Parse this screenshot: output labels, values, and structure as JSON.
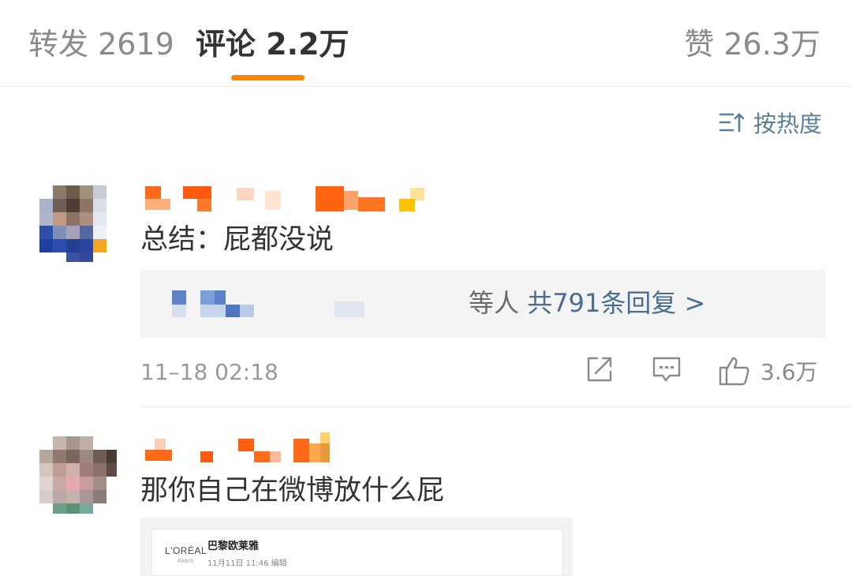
{
  "tabs": {
    "repost": "转发 2619",
    "comment": "评论 2.2万",
    "like": "赞 26.3万"
  },
  "sort": {
    "label": "按热度",
    "icon": "sort-icon"
  },
  "comments": [
    {
      "text": "总结：屁都没说",
      "reply_suffix": "等人",
      "reply_count": "共791条回复 >",
      "time": "11–18 02:18",
      "likes": "3.6万"
    },
    {
      "text": "那你自己在微博放什么屁",
      "embedded": {
        "logo": "L'ORÉAL",
        "logo_sub": "PARIS",
        "name": "巴黎欧莱雅",
        "date": "11月11日 11:46  编辑"
      }
    }
  ],
  "colors": {
    "accent": "#ff8200",
    "link": "#4b6e90",
    "muted": "#999999"
  }
}
